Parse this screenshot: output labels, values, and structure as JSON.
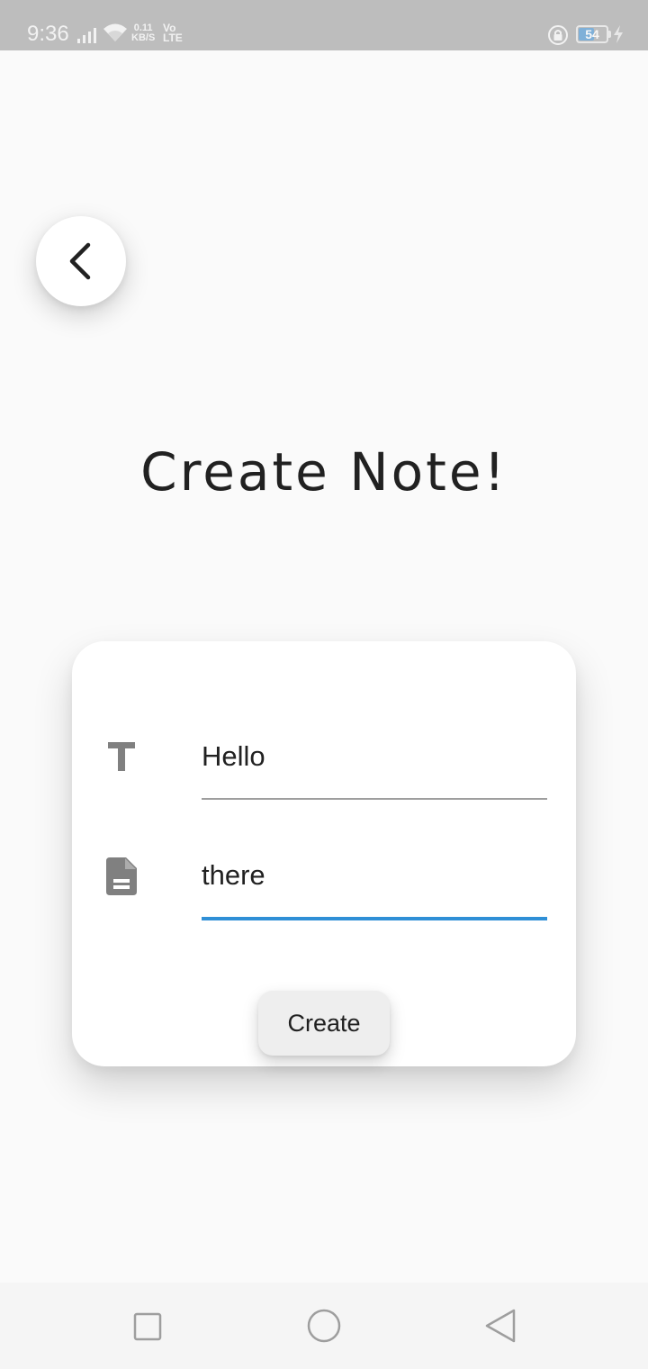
{
  "status_bar": {
    "time": "9:36",
    "net_speed_value": "0.11",
    "net_speed_unit": "KB/S",
    "volte_top": "Vo",
    "volte_bottom": "LTE",
    "battery_level": "54",
    "battery_fraction": 0.54
  },
  "icons": {
    "back": "chevron-left-icon",
    "title_field": "text-title-icon",
    "body_field": "document-icon",
    "nav_recents": "square-icon",
    "nav_home": "circle-icon",
    "nav_back": "triangle-back-icon"
  },
  "page": {
    "title": "Create Note!"
  },
  "form": {
    "title_value": "Hello",
    "body_value": "there",
    "create_label": "Create"
  },
  "colors": {
    "focus_accent": "#2f8fd6",
    "status_bar_bg": "#bdbdbd",
    "background": "#fafafa"
  }
}
